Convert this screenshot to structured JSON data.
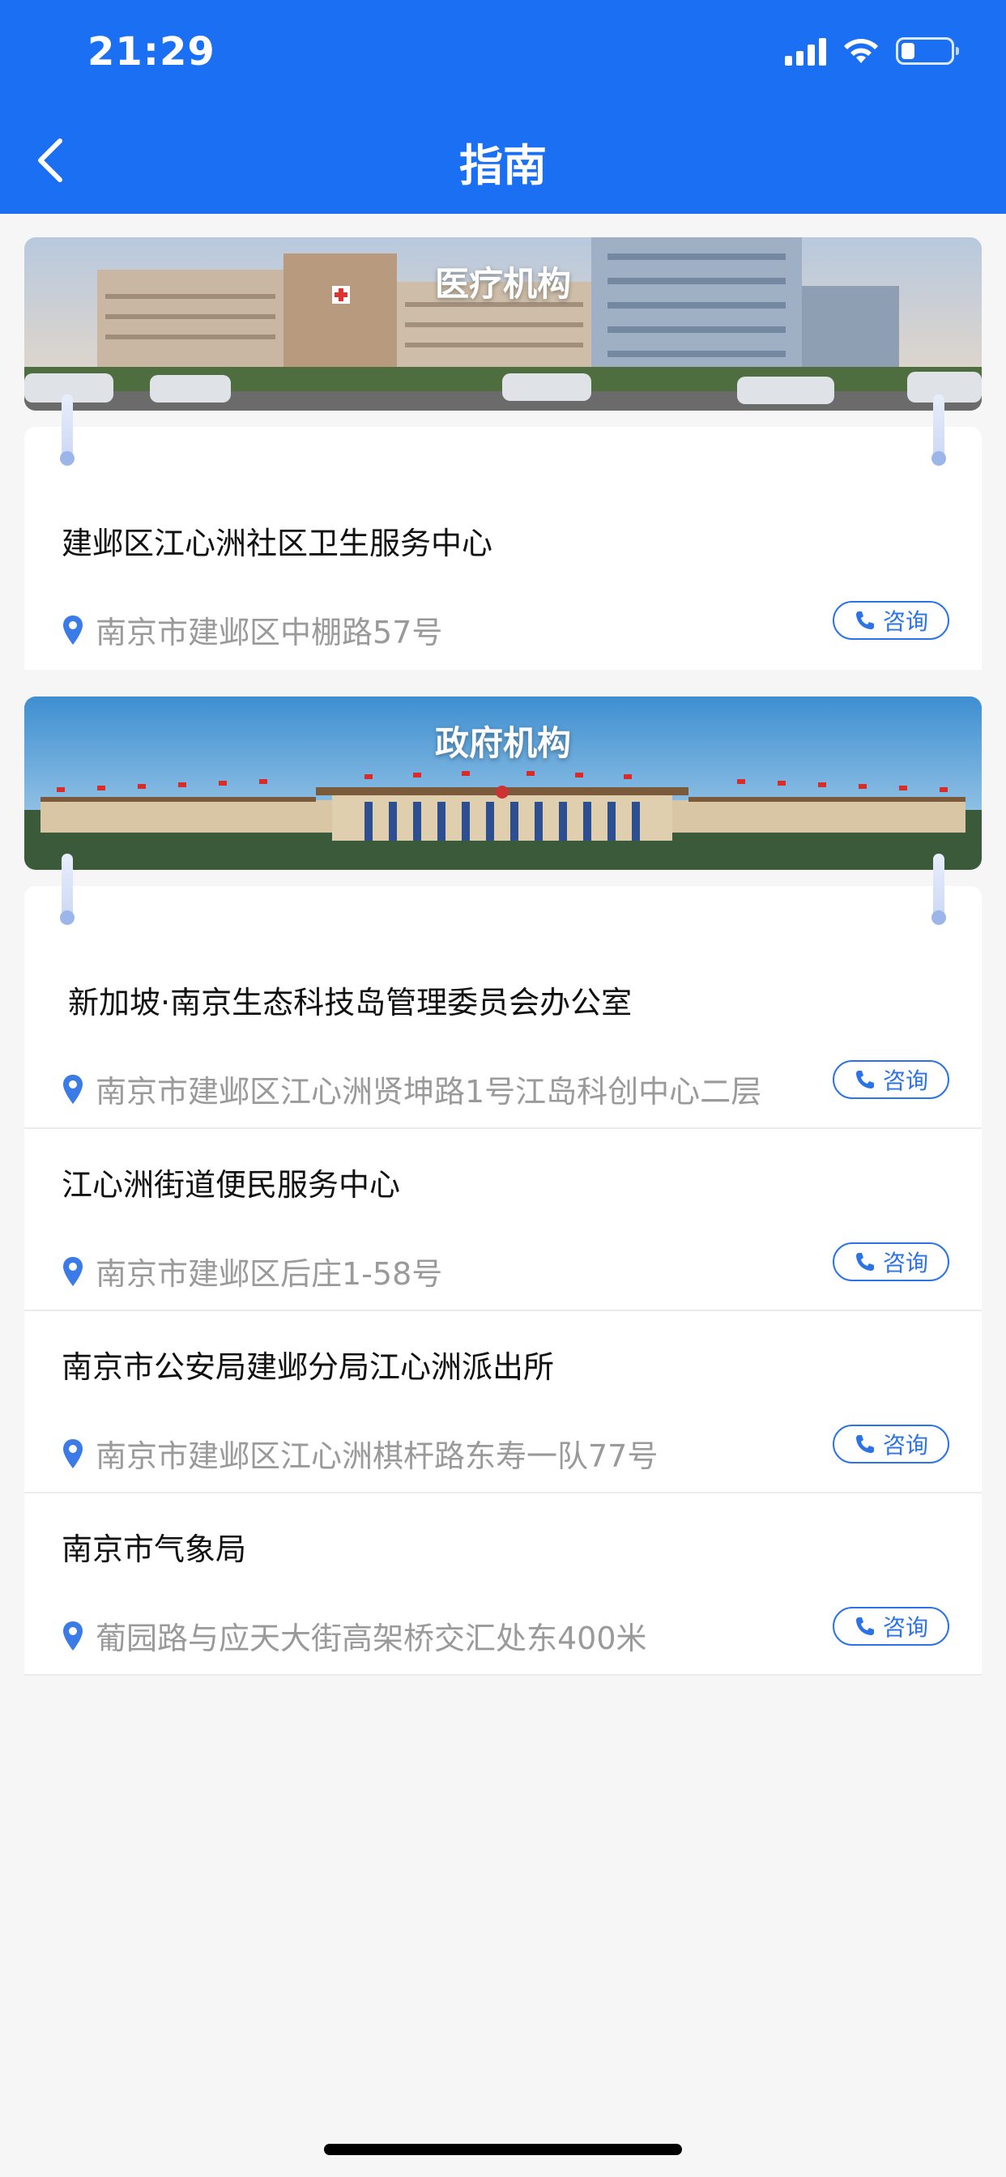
{
  "status_bar": {
    "time": "21:29"
  },
  "header": {
    "title": "指南"
  },
  "sections": [
    {
      "banner_title": "医疗机构",
      "items": [
        {
          "name": "建邺区江心洲社区卫生服务中心",
          "address": "南京市建邺区中棚路57号",
          "button_label": "咨询"
        }
      ]
    },
    {
      "banner_title": "政府机构",
      "items": [
        {
          "name": "新加坡·南京生态科技岛管理委员会办公室",
          "address": "南京市建邺区江心洲贤坤路1号江岛科创中心二层",
          "button_label": "咨询"
        },
        {
          "name": "江心洲街道便民服务中心",
          "address": "南京市建邺区后庄1-58号",
          "button_label": "咨询"
        },
        {
          "name": "南京市公安局建邺分局江心洲派出所",
          "address": "南京市建邺区江心洲棋杆路东寿一队77号",
          "button_label": "咨询"
        },
        {
          "name": "南京市气象局",
          "address": "葡园路与应天大街高架桥交汇处东400米",
          "button_label": "咨询"
        }
      ]
    }
  ],
  "colors": {
    "header": "#1b6ff2",
    "accent": "#2b73e6",
    "background": "#f6f6f6"
  }
}
